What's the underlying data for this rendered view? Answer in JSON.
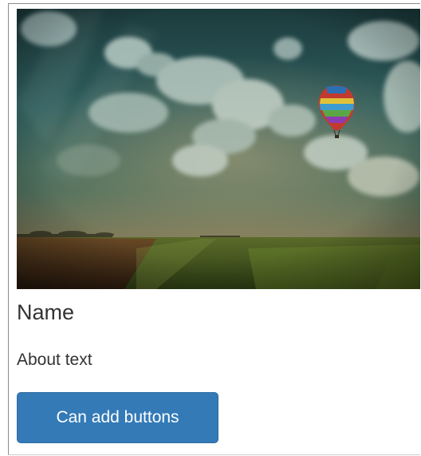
{
  "card": {
    "image_alt": "Hot air balloon over a field under a cloudy sky",
    "name": "Name",
    "about": "About text",
    "button_label": "Can add buttons"
  },
  "colors": {
    "button_bg": "#337ab7",
    "button_text": "#ffffff",
    "text": "#333333"
  },
  "icons": {
    "balloon": "hot-air-balloon"
  }
}
